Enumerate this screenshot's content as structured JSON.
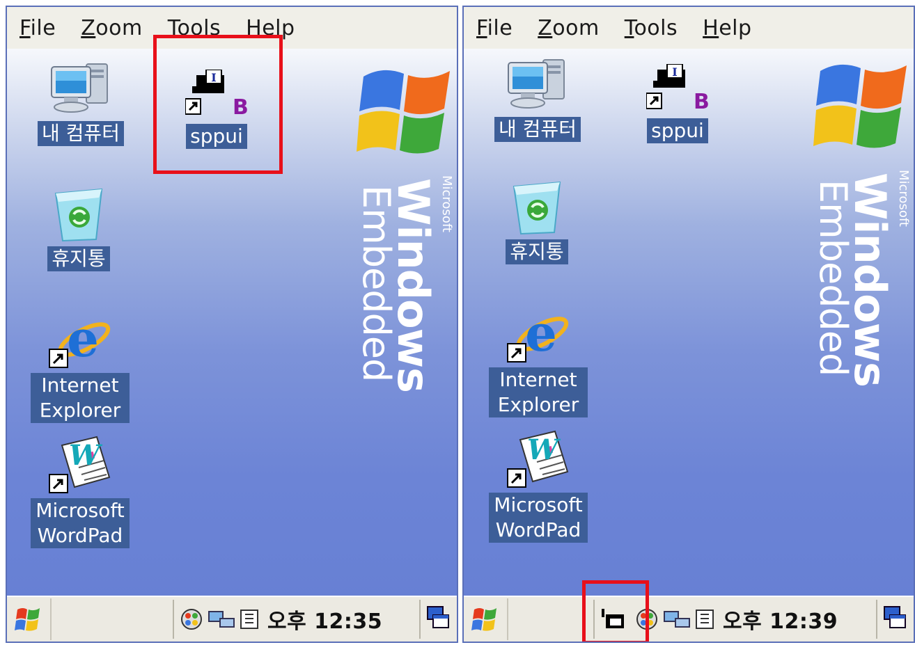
{
  "left": {
    "menu": [
      {
        "mnemonic": "F",
        "rest": "ile"
      },
      {
        "mnemonic": "Z",
        "rest": "oom"
      },
      {
        "mnemonic": "T",
        "rest": "ools"
      },
      {
        "mnemonic": "H",
        "rest": "elp"
      }
    ],
    "icons": {
      "my_computer": "내 컴퓨터",
      "sppui": "sppui",
      "recycle_bin": "휴지통",
      "ie_line1": "Internet",
      "ie_line2": "Explorer",
      "wordpad_line1": "Microsoft",
      "wordpad_line2": "WordPad"
    },
    "logo": {
      "microsoft": "Microsoft",
      "windows": "Windows",
      "embedded": "Embedded"
    },
    "taskbar": {
      "clock": "오후 12:35"
    }
  },
  "right": {
    "menu": [
      {
        "mnemonic": "F",
        "rest": "ile"
      },
      {
        "mnemonic": "Z",
        "rest": "oom"
      },
      {
        "mnemonic": "T",
        "rest": "ools"
      },
      {
        "mnemonic": "H",
        "rest": "elp"
      }
    ],
    "icons": {
      "my_computer": "내 컴퓨터",
      "sppui": "sppui",
      "recycle_bin": "휴지통",
      "ie_line1": "Internet",
      "ie_line2": "Explorer",
      "wordpad_line1": "Microsoft",
      "wordpad_line2": "WordPad"
    },
    "logo": {
      "microsoft": "Microsoft",
      "windows": "Windows",
      "embedded": "Embedded"
    },
    "taskbar": {
      "clock": "오후 12:39"
    }
  },
  "colors": {
    "highlight": "#e8101a",
    "label_bg": "#3d5e98",
    "desktop_blue": "#6c84d6"
  },
  "icon_names": [
    "computer-icon",
    "sppui-icon",
    "recycle-bin-icon",
    "internet-explorer-icon",
    "wordpad-icon",
    "start-icon",
    "network-icon",
    "input-method-icon",
    "show-desktop-icon",
    "sppui-tray-icon"
  ]
}
